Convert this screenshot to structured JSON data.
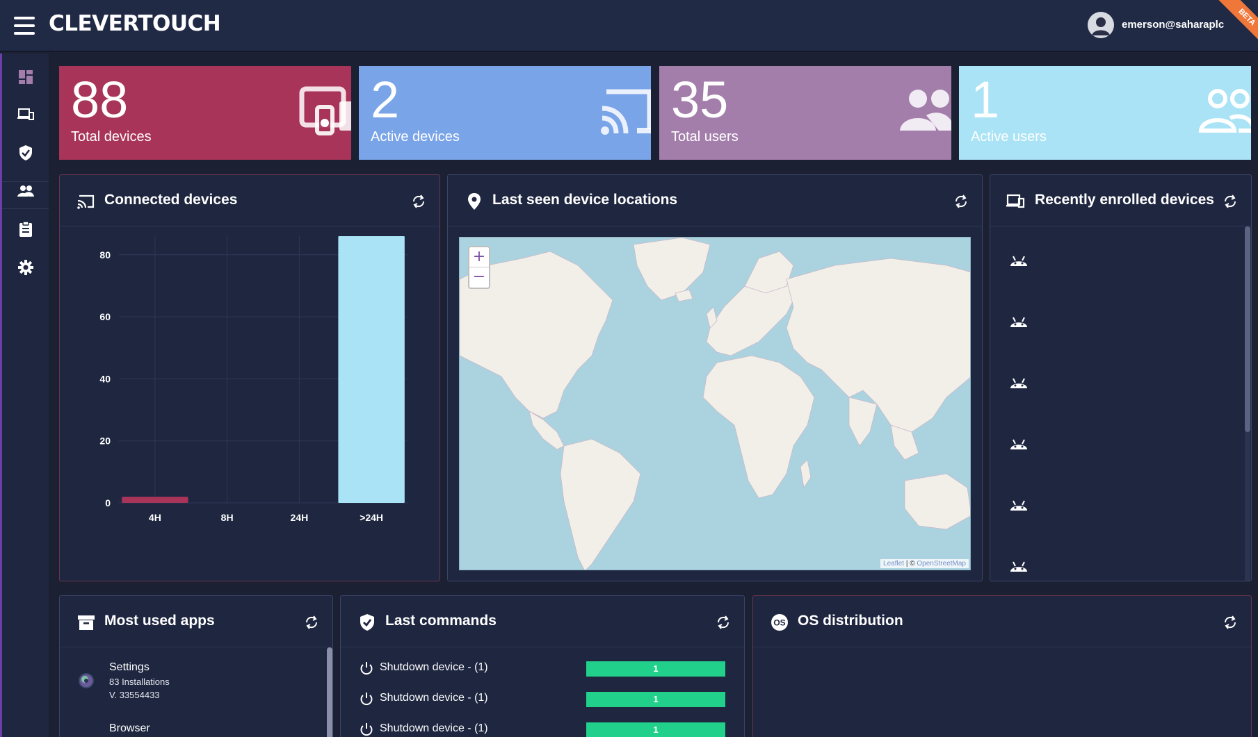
{
  "header": {
    "brand": "CLEVERTOUCH",
    "user_email": "emerson@saharaplc",
    "beta_label": "BETA"
  },
  "sidebar": {
    "items": [
      {
        "name": "dashboard",
        "icon": "dashboard-icon",
        "active": true
      },
      {
        "name": "devices",
        "icon": "devices-icon"
      },
      {
        "name": "policies",
        "icon": "shield-check-icon"
      },
      {
        "name": "users",
        "icon": "users-icon"
      },
      {
        "name": "reports",
        "icon": "clipboard-icon"
      },
      {
        "name": "settings",
        "icon": "gear-icon"
      }
    ]
  },
  "stats": [
    {
      "value": "88",
      "label": "Total devices",
      "color": "#a8345a",
      "icon": "devices-icon"
    },
    {
      "value": "2",
      "label": "Active devices",
      "color": "#79a4e8",
      "icon": "cast-icon"
    },
    {
      "value": "35",
      "label": "Total users",
      "color": "#a47eab",
      "icon": "users-icon"
    },
    {
      "value": "1",
      "label": "Active users",
      "color": "#a9e3f5",
      "icon": "users-outline-icon"
    }
  ],
  "connected": {
    "title": "Connected devices",
    "chart_data": {
      "type": "bar",
      "categories": [
        "4H",
        "8H",
        "24H",
        ">24H"
      ],
      "values": [
        2,
        0,
        0,
        86
      ],
      "ylim": [
        0,
        86
      ],
      "yticks": [
        0,
        20,
        40,
        60,
        80
      ],
      "colors": [
        "#a8345a",
        "#a8345a",
        "#a8345a",
        "#a9e3f5"
      ],
      "grid": true
    }
  },
  "locations": {
    "title": "Last seen device locations",
    "zoom_in": "+",
    "zoom_out": "−",
    "attribution_leaflet": "Leaflet",
    "attribution_sep": " | © ",
    "attribution_osm": "OpenStreetMap"
  },
  "enrolled": {
    "title": "Recently enrolled devices",
    "items": [
      {
        "icon": "android-icon"
      },
      {
        "icon": "android-icon"
      },
      {
        "icon": "android-icon"
      },
      {
        "icon": "android-icon"
      },
      {
        "icon": "android-icon"
      },
      {
        "icon": "android-icon"
      }
    ]
  },
  "apps": {
    "title": "Most used apps",
    "items": [
      {
        "name": "Settings",
        "installs": "83 Installations",
        "version": "V. 33554433"
      },
      {
        "name": "Browser"
      }
    ]
  },
  "commands": {
    "title": "Last commands",
    "items": [
      {
        "label": "Shutdown device  - (1)",
        "count": "1"
      },
      {
        "label": "Shutdown device  - (1)",
        "count": "1"
      },
      {
        "label": "Shutdown device  - (1)",
        "count": "1"
      }
    ]
  },
  "os": {
    "title": "OS distribution",
    "badge": "OS"
  }
}
